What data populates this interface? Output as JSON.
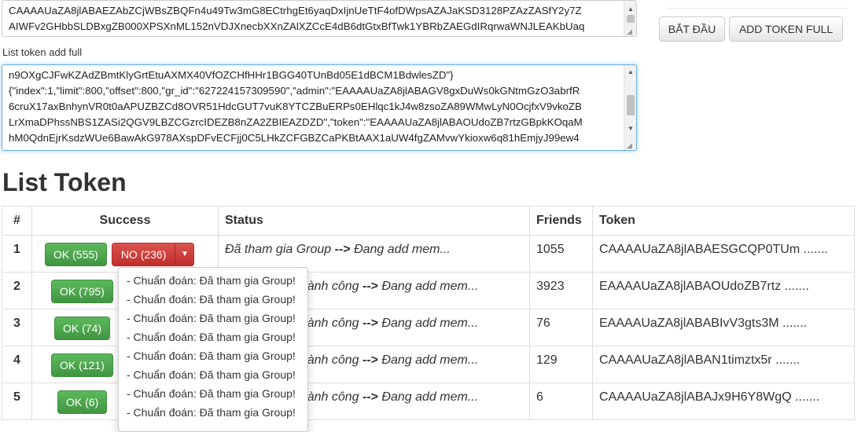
{
  "token_input": {
    "lines": [
      "CAAAAUaZA8jlABAEZAbZCjWBsZBQFn4u49Tw3mG8ECtrhgEt6yaqDxIjnUeTtF4ofDWpsAZAJaKSD3128PZAzZASfY2y7Z",
      "AIWFv2GHbbSLDBxgZB000XPSXnML152nVDJXnecbXXnZAlXZCcE4dB6dtGtxBfTwk1YBRbZAEGdIRqrwaWNJLEAKbUaq"
    ]
  },
  "buttons": {
    "start": "BẮT ĐẦU",
    "add_token_full": "ADD TOKEN FULL"
  },
  "list_token_full": {
    "label": "List token add full",
    "lines": [
      "n9OXgCJFwKZAdZBmtKlyGrtEtuAXMX40VfOZCHfHHr1BGG40TUnBd05E1dBCM1BdwlesZD\"}",
      "{\"index\":1,\"limit\":800,\"offset\":800,\"gr_id\":\"627224157309590\",\"admin\":\"EAAAAUaZA8jlABAGV8gxDuWs0kGNtmGzO3abrfR",
      "6cruX17axBnhynVR0t0aAPUZBZCd8OVR51HdcGUT7vuK8YTCZBuERPs0EHlqc1kJ4w8zsoZA89WMwLyN0OcjfxV9vkoZB",
      "LrXmaDPhssNBS1ZASi2QGV9LBZCGzrcIDEZB8nZA2ZBIEAZDZD\",\"token\":\"EAAAAUaZA8jlABAOUdoZB7rtzGBpkKOqaM",
      "hM0QdnEjrKsdzWUe6BawAkG978AXspDFvECFjj0C5LHkZCFGBZCaPKBtAAX1aUW4fgZAMvwYkioxw6q81hEmjyJ99ew4"
    ]
  },
  "list_token_heading": "List Token",
  "table": {
    "headers": [
      "#",
      "Success",
      "Status",
      "Friends",
      "Token"
    ],
    "rows": [
      {
        "idx": "1",
        "ok": "OK (555)",
        "no": "NO (236)",
        "status_a": "Đã tham gia Group ",
        "arrow": "-->",
        "status_b": " Đang add mem...",
        "friends": "1055",
        "token": "CAAAAUaZA8jlABAESGCQP0TUm ......."
      },
      {
        "idx": "2",
        "ok": "OK (795)",
        "no": "",
        "status_a": "p thành công ",
        "arrow": "-->",
        "status_b": " Đang add mem...",
        "friends": "3923",
        "token": "EAAAAUaZA8jlABAOUdoZB7rtz ......."
      },
      {
        "idx": "3",
        "ok": "OK (74)",
        "no": "",
        "status_a": "p thành công ",
        "arrow": "-->",
        "status_b": " Đang add mem...",
        "friends": "76",
        "token": "EAAAAUaZA8jlABABIvV3gts3M ......."
      },
      {
        "idx": "4",
        "ok": "OK (121)",
        "no": "",
        "status_a": "p thành công ",
        "arrow": "-->",
        "status_b": " Đang add mem...",
        "friends": "129",
        "token": "CAAAAUaZA8jlABAN1timztx5r ......."
      },
      {
        "idx": "5",
        "ok": "OK (6)",
        "no": "",
        "status_a": "p thành công ",
        "arrow": "-->",
        "status_b": " Đang add mem...",
        "friends": "6",
        "token": "CAAAAUaZA8jlABAJx9H6Y8WgQ ......."
      }
    ]
  },
  "dropdown_items": [
    "- Chuẩn đoán: Đã tham gia Group!",
    "- Chuẩn đoán: Đã tham gia Group!",
    "- Chuẩn đoán: Đã tham gia Group!",
    "- Chuẩn đoán: Đã tham gia Group!",
    "- Chuẩn đoán: Đã tham gia Group!",
    "- Chuẩn đoán: Đã tham gia Group!",
    "- Chuẩn đoán: Đã tham gia Group!",
    "- Chuẩn đoán: Đã tham gia Group!"
  ],
  "icons": {
    "scroll_up": "scroll-up-arrow-icon",
    "scroll_down": "scroll-down-arrow-icon",
    "caret": "caret-down-icon",
    "resize": "resize-grip-icon"
  },
  "colors": {
    "ok_green": "#5cb85c",
    "no_red": "#d9534f",
    "focus_blue": "#66afe9"
  }
}
